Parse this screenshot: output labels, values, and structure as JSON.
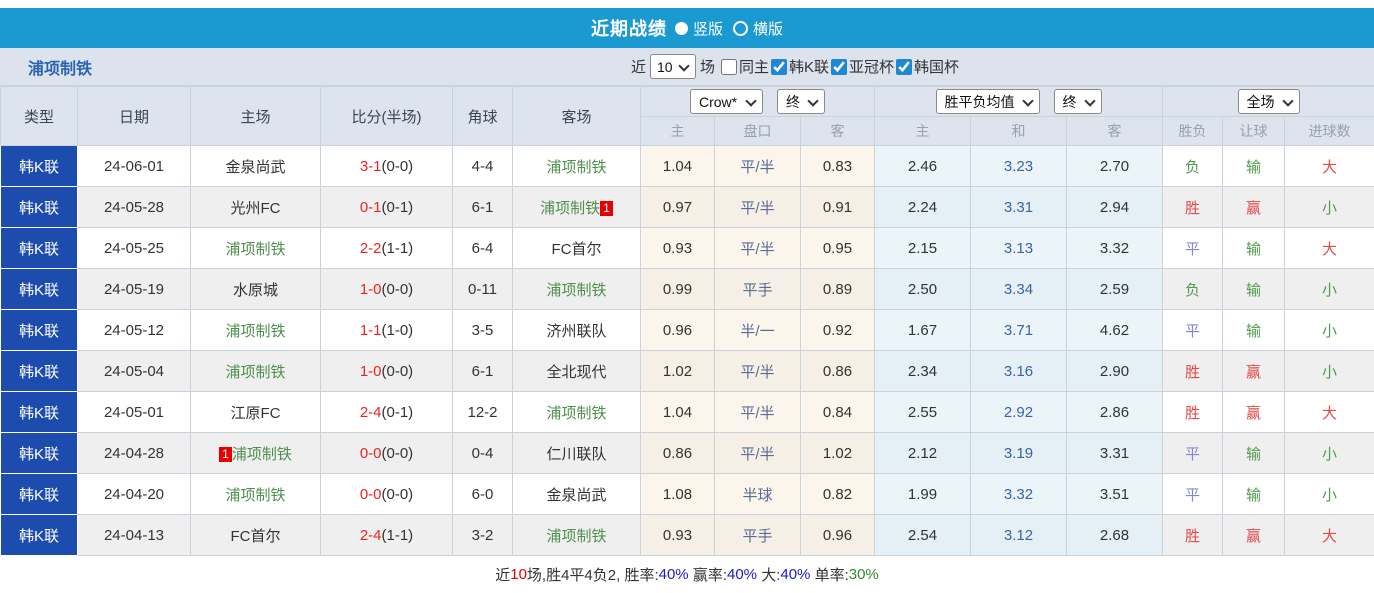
{
  "colors": {
    "titlebar_bg": "#1b9ad2",
    "filterbar_bg": "#dce3ed",
    "league_cell_bg": "#1c4cae",
    "handicap_col_bg": "#fbf5ec",
    "europe_col_bg": "#eaf4f9",
    "team_highlight": "#4f8f4f",
    "score_red": "#ee2222",
    "result_red": "#e14a4a",
    "result_green": "#4f9b4f",
    "result_blue": "#8585d8"
  },
  "title_bar": {
    "title": "近期战绩",
    "radio_options": [
      {
        "label": "竖版",
        "selected": true
      },
      {
        "label": "横版",
        "selected": false
      }
    ]
  },
  "filter_bar": {
    "team_name": "浦项制铁",
    "recent_label": "近",
    "matches_value": "10",
    "matches_label": "场",
    "checkboxes": [
      {
        "label": "同主",
        "checked": false
      },
      {
        "label": "韩K联",
        "checked": true
      },
      {
        "label": "亚冠杯",
        "checked": true
      },
      {
        "label": "韩国杯",
        "checked": true
      }
    ]
  },
  "table": {
    "left_headers": [
      "类型",
      "日期",
      "主场",
      "比分(半场)",
      "角球",
      "客场"
    ],
    "groups": [
      {
        "selects": [
          "Crow*",
          "终"
        ],
        "subheaders": [
          "主",
          "盘口",
          "客"
        ]
      },
      {
        "selects": [
          "胜平负均值",
          "终"
        ],
        "subheaders": [
          "主",
          "和",
          "客"
        ]
      },
      {
        "selects": [
          "全场"
        ],
        "subheaders": [
          "胜负",
          "让球",
          "进球数"
        ]
      }
    ],
    "rows": [
      {
        "league": "韩K联",
        "date": "24-06-01",
        "home": {
          "name": "金泉尚武",
          "highlight": false,
          "badge": null
        },
        "score": "3-1",
        "half": "(0-0)",
        "corner": "4-4",
        "away": {
          "name": "浦项制铁",
          "highlight": true,
          "badge": null
        },
        "ah_home": "1.04",
        "ah_line": "平/半",
        "ah_away": "0.83",
        "eu_home": "2.46",
        "eu_draw": "3.23",
        "eu_away": "2.70",
        "result": {
          "text": "负",
          "color": "green"
        },
        "handicap_result": {
          "text": "输",
          "color": "green"
        },
        "goals_result": {
          "text": "大",
          "color": "red"
        }
      },
      {
        "league": "韩K联",
        "date": "24-05-28",
        "home": {
          "name": "光州FC",
          "highlight": false,
          "badge": null
        },
        "score": "0-1",
        "half": "(0-1)",
        "corner": "6-1",
        "away": {
          "name": "浦项制铁",
          "highlight": true,
          "badge": {
            "text": "1",
            "pos": "after"
          }
        },
        "ah_home": "0.97",
        "ah_line": "平/半",
        "ah_away": "0.91",
        "eu_home": "2.24",
        "eu_draw": "3.31",
        "eu_away": "2.94",
        "result": {
          "text": "胜",
          "color": "red"
        },
        "handicap_result": {
          "text": "赢",
          "color": "red"
        },
        "goals_result": {
          "text": "小",
          "color": "green"
        }
      },
      {
        "league": "韩K联",
        "date": "24-05-25",
        "home": {
          "name": "浦项制铁",
          "highlight": true,
          "badge": null
        },
        "score": "2-2",
        "half": "(1-1)",
        "corner": "6-4",
        "away": {
          "name": "FC首尔",
          "highlight": false,
          "badge": null
        },
        "ah_home": "0.93",
        "ah_line": "平/半",
        "ah_away": "0.95",
        "eu_home": "2.15",
        "eu_draw": "3.13",
        "eu_away": "3.32",
        "result": {
          "text": "平",
          "color": "blue"
        },
        "handicap_result": {
          "text": "输",
          "color": "green"
        },
        "goals_result": {
          "text": "大",
          "color": "red"
        }
      },
      {
        "league": "韩K联",
        "date": "24-05-19",
        "home": {
          "name": "水原城",
          "highlight": false,
          "badge": null
        },
        "score": "1-0",
        "half": "(0-0)",
        "corner": "0-11",
        "away": {
          "name": "浦项制铁",
          "highlight": true,
          "badge": null
        },
        "ah_home": "0.99",
        "ah_line": "平手",
        "ah_away": "0.89",
        "eu_home": "2.50",
        "eu_draw": "3.34",
        "eu_away": "2.59",
        "result": {
          "text": "负",
          "color": "green"
        },
        "handicap_result": {
          "text": "输",
          "color": "green"
        },
        "goals_result": {
          "text": "小",
          "color": "green"
        }
      },
      {
        "league": "韩K联",
        "date": "24-05-12",
        "home": {
          "name": "浦项制铁",
          "highlight": true,
          "badge": null
        },
        "score": "1-1",
        "half": "(1-0)",
        "corner": "3-5",
        "away": {
          "name": "济州联队",
          "highlight": false,
          "badge": null
        },
        "ah_home": "0.96",
        "ah_line": "半/一",
        "ah_away": "0.92",
        "eu_home": "1.67",
        "eu_draw": "3.71",
        "eu_away": "4.62",
        "result": {
          "text": "平",
          "color": "blue"
        },
        "handicap_result": {
          "text": "输",
          "color": "green"
        },
        "goals_result": {
          "text": "小",
          "color": "green"
        }
      },
      {
        "league": "韩K联",
        "date": "24-05-04",
        "home": {
          "name": "浦项制铁",
          "highlight": true,
          "badge": null
        },
        "score": "1-0",
        "half": "(0-0)",
        "corner": "6-1",
        "away": {
          "name": "全北现代",
          "highlight": false,
          "badge": null
        },
        "ah_home": "1.02",
        "ah_line": "平/半",
        "ah_away": "0.86",
        "eu_home": "2.34",
        "eu_draw": "3.16",
        "eu_away": "2.90",
        "result": {
          "text": "胜",
          "color": "red"
        },
        "handicap_result": {
          "text": "赢",
          "color": "red"
        },
        "goals_result": {
          "text": "小",
          "color": "green"
        }
      },
      {
        "league": "韩K联",
        "date": "24-05-01",
        "home": {
          "name": "江原FC",
          "highlight": false,
          "badge": null
        },
        "score": "2-4",
        "half": "(0-1)",
        "corner": "12-2",
        "away": {
          "name": "浦项制铁",
          "highlight": true,
          "badge": null
        },
        "ah_home": "1.04",
        "ah_line": "平/半",
        "ah_away": "0.84",
        "eu_home": "2.55",
        "eu_draw": "2.92",
        "eu_away": "2.86",
        "result": {
          "text": "胜",
          "color": "red"
        },
        "handicap_result": {
          "text": "赢",
          "color": "red"
        },
        "goals_result": {
          "text": "大",
          "color": "red"
        }
      },
      {
        "league": "韩K联",
        "date": "24-04-28",
        "home": {
          "name": "浦项制铁",
          "highlight": true,
          "badge": {
            "text": "1",
            "pos": "before"
          }
        },
        "score": "0-0",
        "half": "(0-0)",
        "corner": "0-4",
        "away": {
          "name": "仁川联队",
          "highlight": false,
          "badge": null
        },
        "ah_home": "0.86",
        "ah_line": "平/半",
        "ah_away": "1.02",
        "eu_home": "2.12",
        "eu_draw": "3.19",
        "eu_away": "3.31",
        "result": {
          "text": "平",
          "color": "blue"
        },
        "handicap_result": {
          "text": "输",
          "color": "green"
        },
        "goals_result": {
          "text": "小",
          "color": "green"
        }
      },
      {
        "league": "韩K联",
        "date": "24-04-20",
        "home": {
          "name": "浦项制铁",
          "highlight": true,
          "badge": null
        },
        "score": "0-0",
        "half": "(0-0)",
        "corner": "6-0",
        "away": {
          "name": "金泉尚武",
          "highlight": false,
          "badge": null
        },
        "ah_home": "1.08",
        "ah_line": "半球",
        "ah_away": "0.82",
        "eu_home": "1.99",
        "eu_draw": "3.32",
        "eu_away": "3.51",
        "result": {
          "text": "平",
          "color": "blue"
        },
        "handicap_result": {
          "text": "输",
          "color": "green"
        },
        "goals_result": {
          "text": "小",
          "color": "green"
        }
      },
      {
        "league": "韩K联",
        "date": "24-04-13",
        "home": {
          "name": "FC首尔",
          "highlight": false,
          "badge": null
        },
        "score": "2-4",
        "half": "(1-1)",
        "corner": "3-2",
        "away": {
          "name": "浦项制铁",
          "highlight": true,
          "badge": null
        },
        "ah_home": "0.93",
        "ah_line": "平手",
        "ah_away": "0.96",
        "eu_home": "2.54",
        "eu_draw": "3.12",
        "eu_away": "2.68",
        "result": {
          "text": "胜",
          "color": "red"
        },
        "handicap_result": {
          "text": "赢",
          "color": "red"
        },
        "goals_result": {
          "text": "大",
          "color": "red"
        }
      }
    ]
  },
  "footer": {
    "segments": [
      {
        "text": "近",
        "color": "dark"
      },
      {
        "text": "10",
        "color": "red"
      },
      {
        "text": "场,胜4平4负2, 胜率:",
        "color": "dark"
      },
      {
        "text": "40%",
        "color": "blue"
      },
      {
        "text": " 赢率:",
        "color": "dark"
      },
      {
        "text": "40%",
        "color": "blue"
      },
      {
        "text": " 大:",
        "color": "dark"
      },
      {
        "text": "40%",
        "color": "blue"
      },
      {
        "text": " 单率:",
        "color": "dark"
      },
      {
        "text": "30%",
        "color": "green"
      }
    ]
  }
}
